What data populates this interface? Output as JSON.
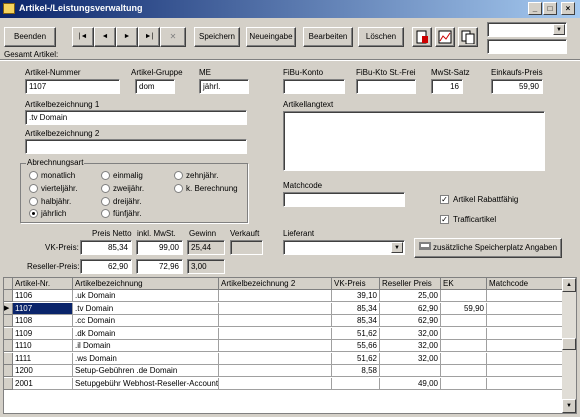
{
  "window": {
    "title": "Artikel-/Leistungsverwaltung"
  },
  "toolbar": {
    "beenden": "Beenden",
    "gesamt_label": "Gesamt Artikel:",
    "nav_first": "|◄",
    "nav_prev": "◄",
    "nav_next": "►",
    "nav_last": "►|",
    "nav_delete": "✕",
    "speichern": "Speichern",
    "neueingabe": "Neueingabe",
    "bearbeiten": "Bearbeiten",
    "loeschen": "Löschen"
  },
  "form": {
    "artikel_nummer_label": "Artikel-Nummer",
    "artikel_nummer": "1107",
    "artikel_gruppe_label": "Artikel-Gruppe",
    "artikel_gruppe": "dom",
    "me_label": "ME",
    "me": "jährl.",
    "fibu_konto_label": "FiBu-Konto",
    "fibu_konto": "",
    "fibu_kto_st_label": "FiBu-Kto St.-Frei",
    "fibu_kto_st": "",
    "mwst_label": "MwSt-Satz",
    "mwst": "16",
    "ek_preis_label": "Einkaufs-Preis",
    "ek_preis": "59,90",
    "bez1_label": "Artikelbezeichnung 1",
    "bez1": ".tv Domain",
    "bez2_label": "Artikelbezeichnung 2",
    "bez2": "",
    "langtext_label": "Artikellangtext",
    "langtext": "",
    "abrechnungsart_label": "Abrechnungsart",
    "radios": [
      "monatlich",
      "einmalig",
      "zehnjähr.",
      "vierteljähr.",
      "zweijähr.",
      "k. Berechnung",
      "halbjähr.",
      "dreijähr.",
      "jährlich",
      "fünfjähr."
    ],
    "matchcode_label": "Matchcode",
    "matchcode": "",
    "rabattfaehig_label": "Artikel Rabattfähig",
    "trafficartikel_label": "Trafficartikel",
    "preis_netto_label": "Preis Netto",
    "inkl_mwst_label": "inkl. MwSt.",
    "gewinn_label": "Gewinn",
    "verkauft_label": "Verkauft",
    "vk_preis_label": "VK-Preis:",
    "vk_netto": "85,34",
    "vk_brutto": "99,00",
    "vk_gewinn": "25,44",
    "reseller_label": "Reseller-Preis:",
    "rs_netto": "62,90",
    "rs_brutto": "72,96",
    "rs_gewinn": "3,00",
    "lieferant_label": "Lieferant",
    "lieferant": "",
    "speicherplatz_btn": "zusätzliche Speicherplatz Angaben"
  },
  "grid": {
    "headers": [
      "Artikel-Nr.",
      "Artikelbezeichnung",
      "Artikelbezeichnung 2",
      "VK-Preis",
      "Reseller Preis",
      "EK",
      "Matchcode"
    ],
    "rows": [
      [
        "1106",
        ".uk Domain",
        "",
        "39,10",
        "25,00",
        "",
        ""
      ],
      [
        "1107",
        ".tv Domain",
        "",
        "85,34",
        "62,90",
        "59,90",
        ""
      ],
      [
        "1108",
        ".cc Domain",
        "",
        "85,34",
        "62,90",
        "",
        ""
      ],
      [
        "1109",
        ".dk Domain",
        "",
        "51,62",
        "32,00",
        "",
        ""
      ],
      [
        "1110",
        ".il Domain",
        "",
        "55,66",
        "32,00",
        "",
        ""
      ],
      [
        "1111",
        ".ws Domain",
        "",
        "51,62",
        "32,00",
        "",
        ""
      ],
      [
        "1200",
        "Setup-Gebühren .de Domain",
        "",
        "8,58",
        "",
        "",
        ""
      ],
      [
        "2001",
        "Setupgebühr Webhost-Reseller-Account",
        "",
        "",
        "49,00",
        "",
        ""
      ]
    ],
    "current_row_marker": "▶"
  },
  "colors": {
    "title_start": "#0a246a",
    "title_end": "#a6caf0",
    "face": "#d4d0c8",
    "selected": "#0a246a"
  }
}
